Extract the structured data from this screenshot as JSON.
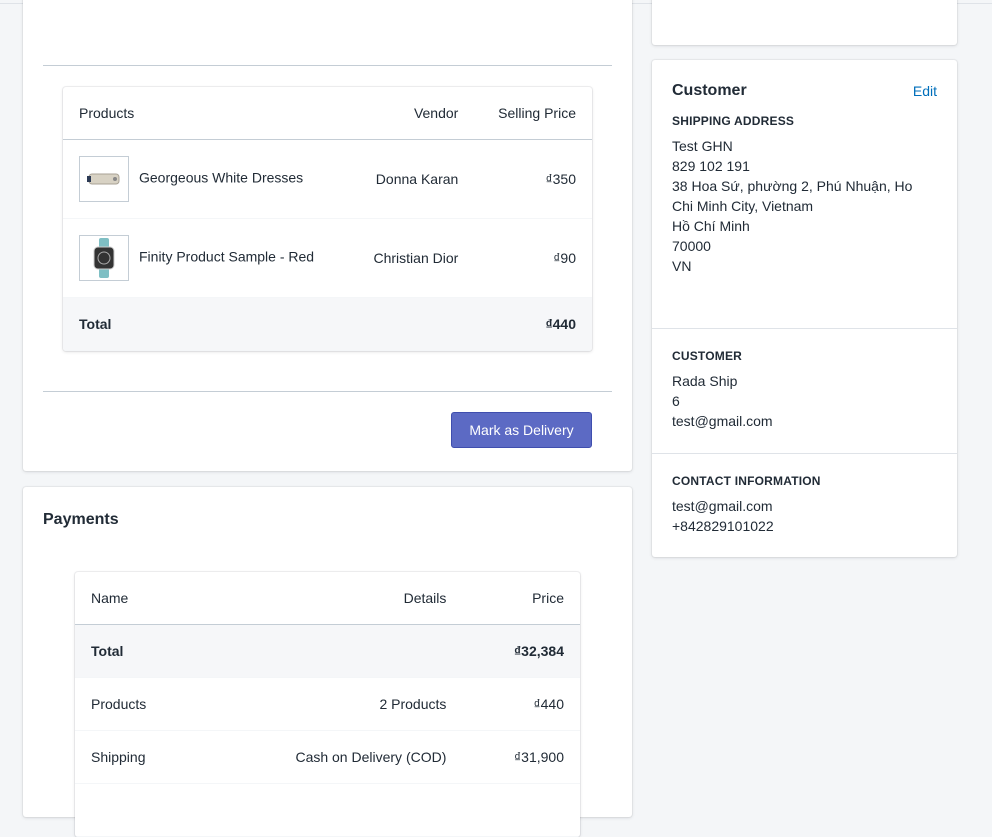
{
  "products": {
    "headers": [
      "Products",
      "Vendor",
      "Selling Price"
    ],
    "rows": [
      {
        "name": "Georgeous White Dresses",
        "vendor": "Donna Karan",
        "price": "₫350",
        "icon": "usb-drive-thumbnail"
      },
      {
        "name": "Finity Product Sample - Red",
        "vendor": "Christian Dior",
        "price": "₫90",
        "icon": "watch-thumbnail"
      }
    ],
    "total_label": "Total",
    "total": "₫440"
  },
  "mark_delivery_label": "Mark as Delivery",
  "payments": {
    "title": "Payments",
    "headers": [
      "Name",
      "Details",
      "Price"
    ],
    "total": {
      "name": "Total",
      "details": "",
      "price": "₫32,384"
    },
    "rows": [
      {
        "name": "Products",
        "details": "2 Products",
        "price": "₫440"
      },
      {
        "name": "Shipping",
        "details": "Cash on Delivery (COD)",
        "price": "₫31,900"
      }
    ]
  },
  "customer": {
    "title": "Customer",
    "edit_label": "Edit",
    "shipping_title": "Shipping address",
    "shipping": [
      "Test GHN",
      "829 102 191",
      "38 Hoa Sứ, phường 2, Phú Nhuận, Ho Chi Minh City, Vietnam",
      "Hồ Chí Minh",
      "70000",
      "VN"
    ],
    "customer_title": "Customer",
    "customer_lines": [
      "Rada Ship",
      "6",
      "test@gmail.com"
    ],
    "contact_title": "Contact information",
    "contact_lines": [
      "test@gmail.com",
      "+842829101022"
    ]
  },
  "colors": {
    "primary": "#5c6ac4",
    "link": "#006fbb"
  }
}
